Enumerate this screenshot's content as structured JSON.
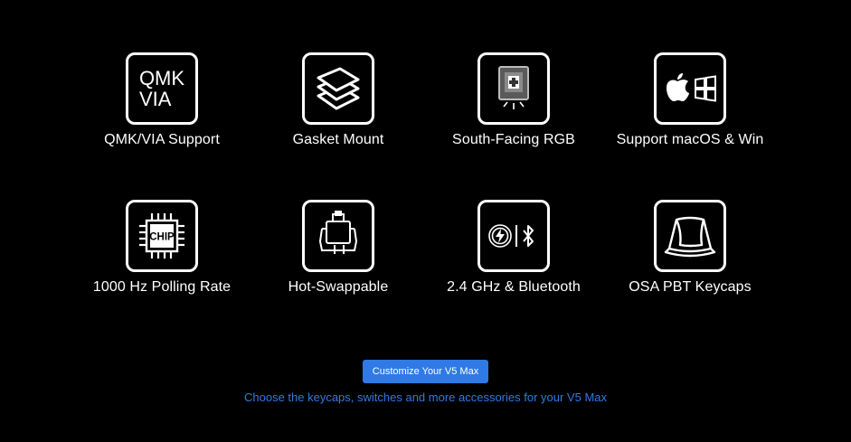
{
  "features": [
    {
      "label": "QMK/VIA Support",
      "icon": "qmk-via-icon",
      "icon_text_1": "QMK",
      "icon_text_2": "VIA"
    },
    {
      "label": "Gasket Mount",
      "icon": "stacked-layers-icon"
    },
    {
      "label": "South-Facing RGB",
      "icon": "switch-rgb-icon"
    },
    {
      "label": "Support macOS & Win",
      "icon": "apple-windows-icon"
    },
    {
      "label": "1000 Hz Polling Rate",
      "icon": "chip-icon",
      "icon_text": "CHIP"
    },
    {
      "label": "Hot-Swappable",
      "icon": "hot-swap-switch-icon"
    },
    {
      "label": "2.4 GHz & Bluetooth",
      "icon": "wireless-bluetooth-icon"
    },
    {
      "label": "OSA PBT Keycaps",
      "icon": "keycap-icon"
    }
  ],
  "cta": {
    "button_label": "Customize Your V5 Max",
    "subtext": "Choose the keycaps, switches and more accessories for your V5 Max"
  },
  "colors": {
    "background": "#000000",
    "accent": "#2f7ae6",
    "text": "#ffffff"
  }
}
